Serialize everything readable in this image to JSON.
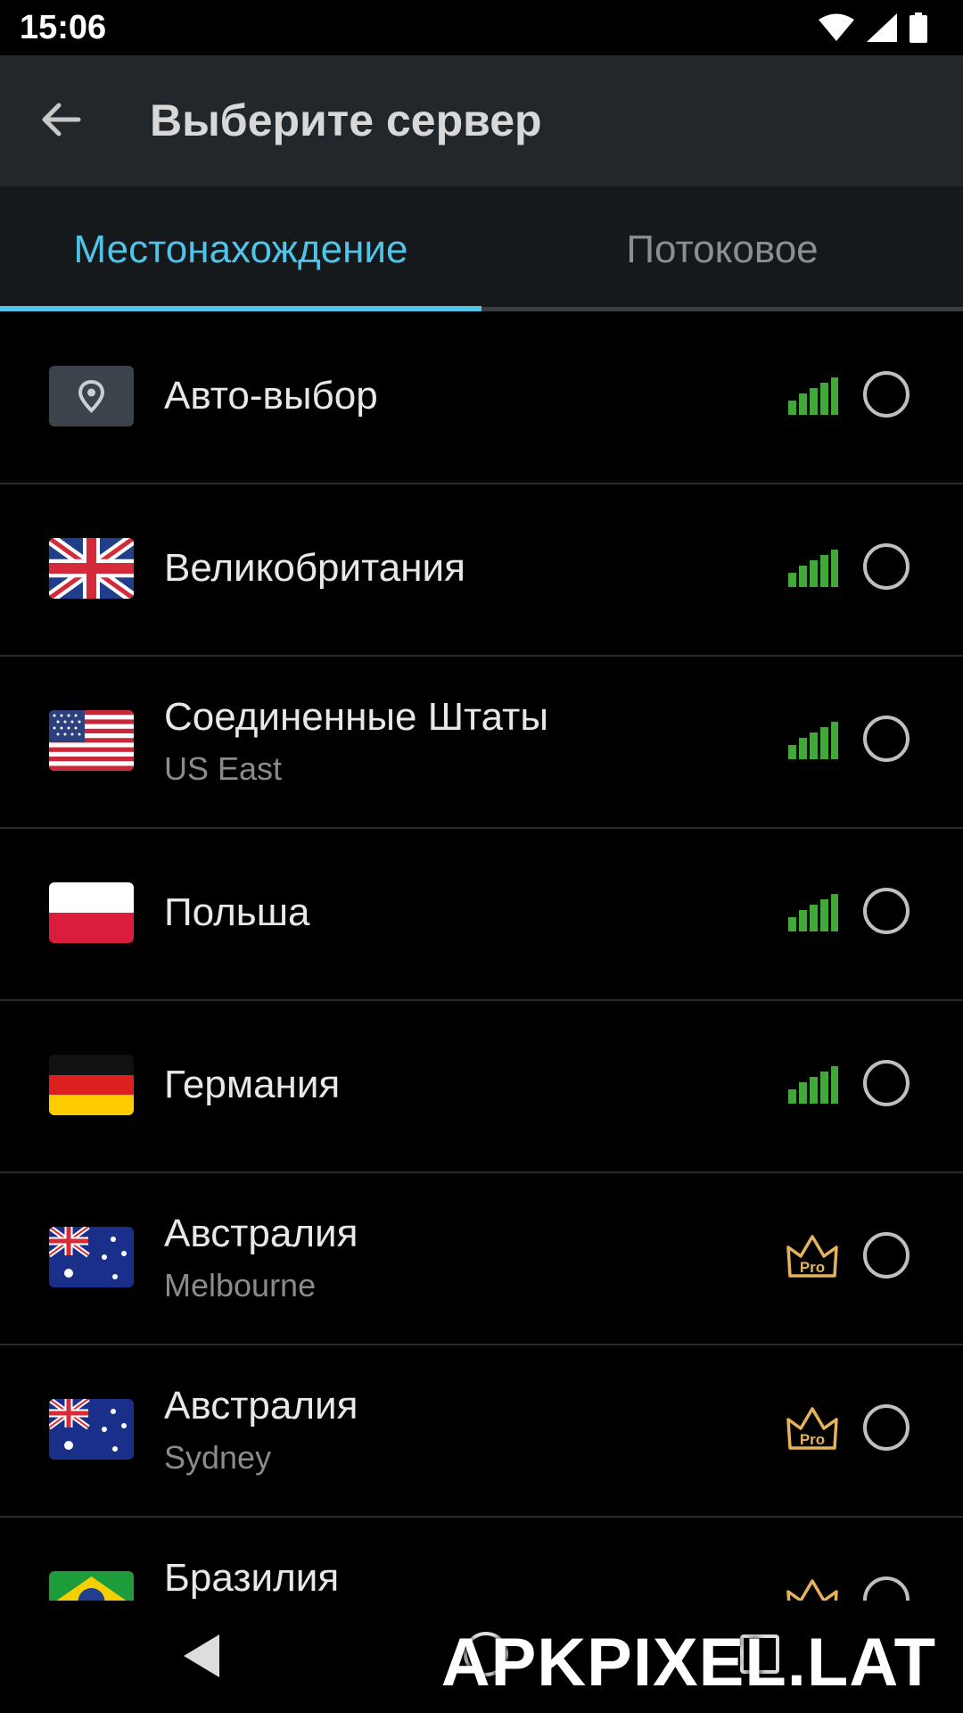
{
  "status_bar": {
    "time": "15:06",
    "icons": [
      "wifi-icon",
      "cell-signal-icon",
      "battery-icon"
    ]
  },
  "app_bar": {
    "back_icon": "arrow-left-icon",
    "title": "Выберите сервер"
  },
  "tabs": [
    {
      "label": "Местонахождение",
      "active": true
    },
    {
      "label": "Потоковое",
      "active": false
    }
  ],
  "colors": {
    "accent": "#4fc3e8",
    "signal": "#43a83a",
    "pro": "#e6b25a",
    "appbar": "#22272b"
  },
  "servers": [
    {
      "name": "Авто-выбор",
      "sub": "",
      "icon": "location-pin-icon",
      "status": "signal",
      "selected": false
    },
    {
      "name": "Великобритания",
      "sub": "",
      "icon": "flag-uk-icon",
      "status": "signal",
      "selected": false
    },
    {
      "name": "Соединенные Штаты",
      "sub": "US East",
      "icon": "flag-us-icon",
      "status": "signal",
      "selected": false
    },
    {
      "name": "Польша",
      "sub": "",
      "icon": "flag-poland-icon",
      "status": "signal",
      "selected": false
    },
    {
      "name": "Германия",
      "sub": "",
      "icon": "flag-germany-icon",
      "status": "signal",
      "selected": false
    },
    {
      "name": "Австралия",
      "sub": "Melbourne",
      "icon": "flag-australia-icon",
      "status": "pro",
      "pro_label": "Pro",
      "selected": false
    },
    {
      "name": "Австралия",
      "sub": "Sydney",
      "icon": "flag-australia-icon",
      "status": "pro",
      "pro_label": "Pro",
      "selected": false
    },
    {
      "name": "Бразилия",
      "sub": "",
      "icon": "flag-brazil-icon",
      "status": "pro",
      "selected": false
    }
  ],
  "nav_bar": {
    "icons": [
      "nav-back-icon",
      "nav-home-icon",
      "nav-recents-icon"
    ]
  },
  "watermark": "APKPIXEL.LAT"
}
